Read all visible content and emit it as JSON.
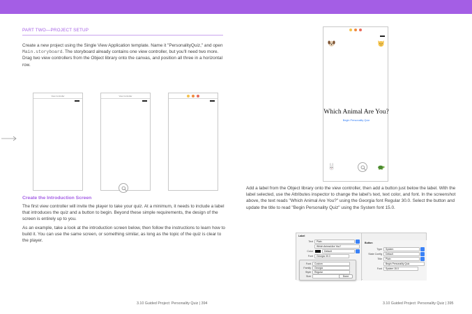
{
  "left_page": {
    "section_label": "PART TWO—PROJECT SETUP",
    "intro_1": "Create a new project using the Single View Application template. Name it \"PersonalityQuiz,\" and open ",
    "intro_code": "Main.storyboard",
    "intro_2": ". The storyboard already contains one view controller, but you'll need two more. Drag two view controllers from the Object library onto the canvas, and position all three in a horizontal row.",
    "vc_header": "View Controller",
    "heading": "Create the Introduction Screen",
    "para_2": "The first view controller will invite the player to take your quiz. At a minimum, it needs to include a label that introduces the quiz and a button to begin. Beyond these simple requirements, the design of the screen is entirely up to you.",
    "para_3": "As an example, take a look at the introduction screen below, then follow the instructions to learn how to build it. You can use the same screen, or something similar, as long as the topic of the quiz is clear to the player.",
    "footer": "3.10 Guided Project: Personality Quiz  |  394"
  },
  "right_page": {
    "phone_title": "Which Animal Are You?",
    "phone_button": "Begin Personality Quiz",
    "emoji_names": [
      "dog-emoji",
      "cat-emoji",
      "rabbit-emoji",
      "turtle-emoji"
    ],
    "para": "Add a label from the Object library onto the view controller, then add a button just below the label. With the label selected, use the Attributes inspector to change the label's text, text color, and font. In the screenshot above, the text reads \"Which Animal Are You?\" using the Georgia font Regular 30.0. Select the button and update the title to read \"Begin Personality Quiz\" using the System font 15.0.",
    "footer": "3.10 Guided Project: Personality Quiz  |  395"
  },
  "inspector": {
    "label_title": "Label",
    "text_label": "Text",
    "text_value": "Plain",
    "text_content": "Which Animal Are You?",
    "color_label": "Color",
    "color_value": "Default",
    "font_label": "Font",
    "font_value": "Georgia 30.0",
    "popup_font_label": "Font",
    "popup_font_value": "Custom",
    "family_label": "Family",
    "family_value": "Georgia",
    "style_label": "Style",
    "style_value": "Regular",
    "size_label": "Size",
    "size_value": "30",
    "done_label": "Done",
    "button_title": "Button",
    "type_label": "Type",
    "type_value": "System",
    "state_label": "State Config",
    "state_value": "Default",
    "title_label": "Title",
    "title_value": "Plain",
    "title_content": "Begin Personality Quiz",
    "bfont_label": "Font",
    "bfont_value": "System 15.0"
  },
  "colors": {
    "accent": "#a45ee5",
    "link": "#2f7cf6",
    "dot_yellow": "#f5c24c",
    "dot_orange": "#f08a3c",
    "dot_red": "#e86a5c"
  }
}
